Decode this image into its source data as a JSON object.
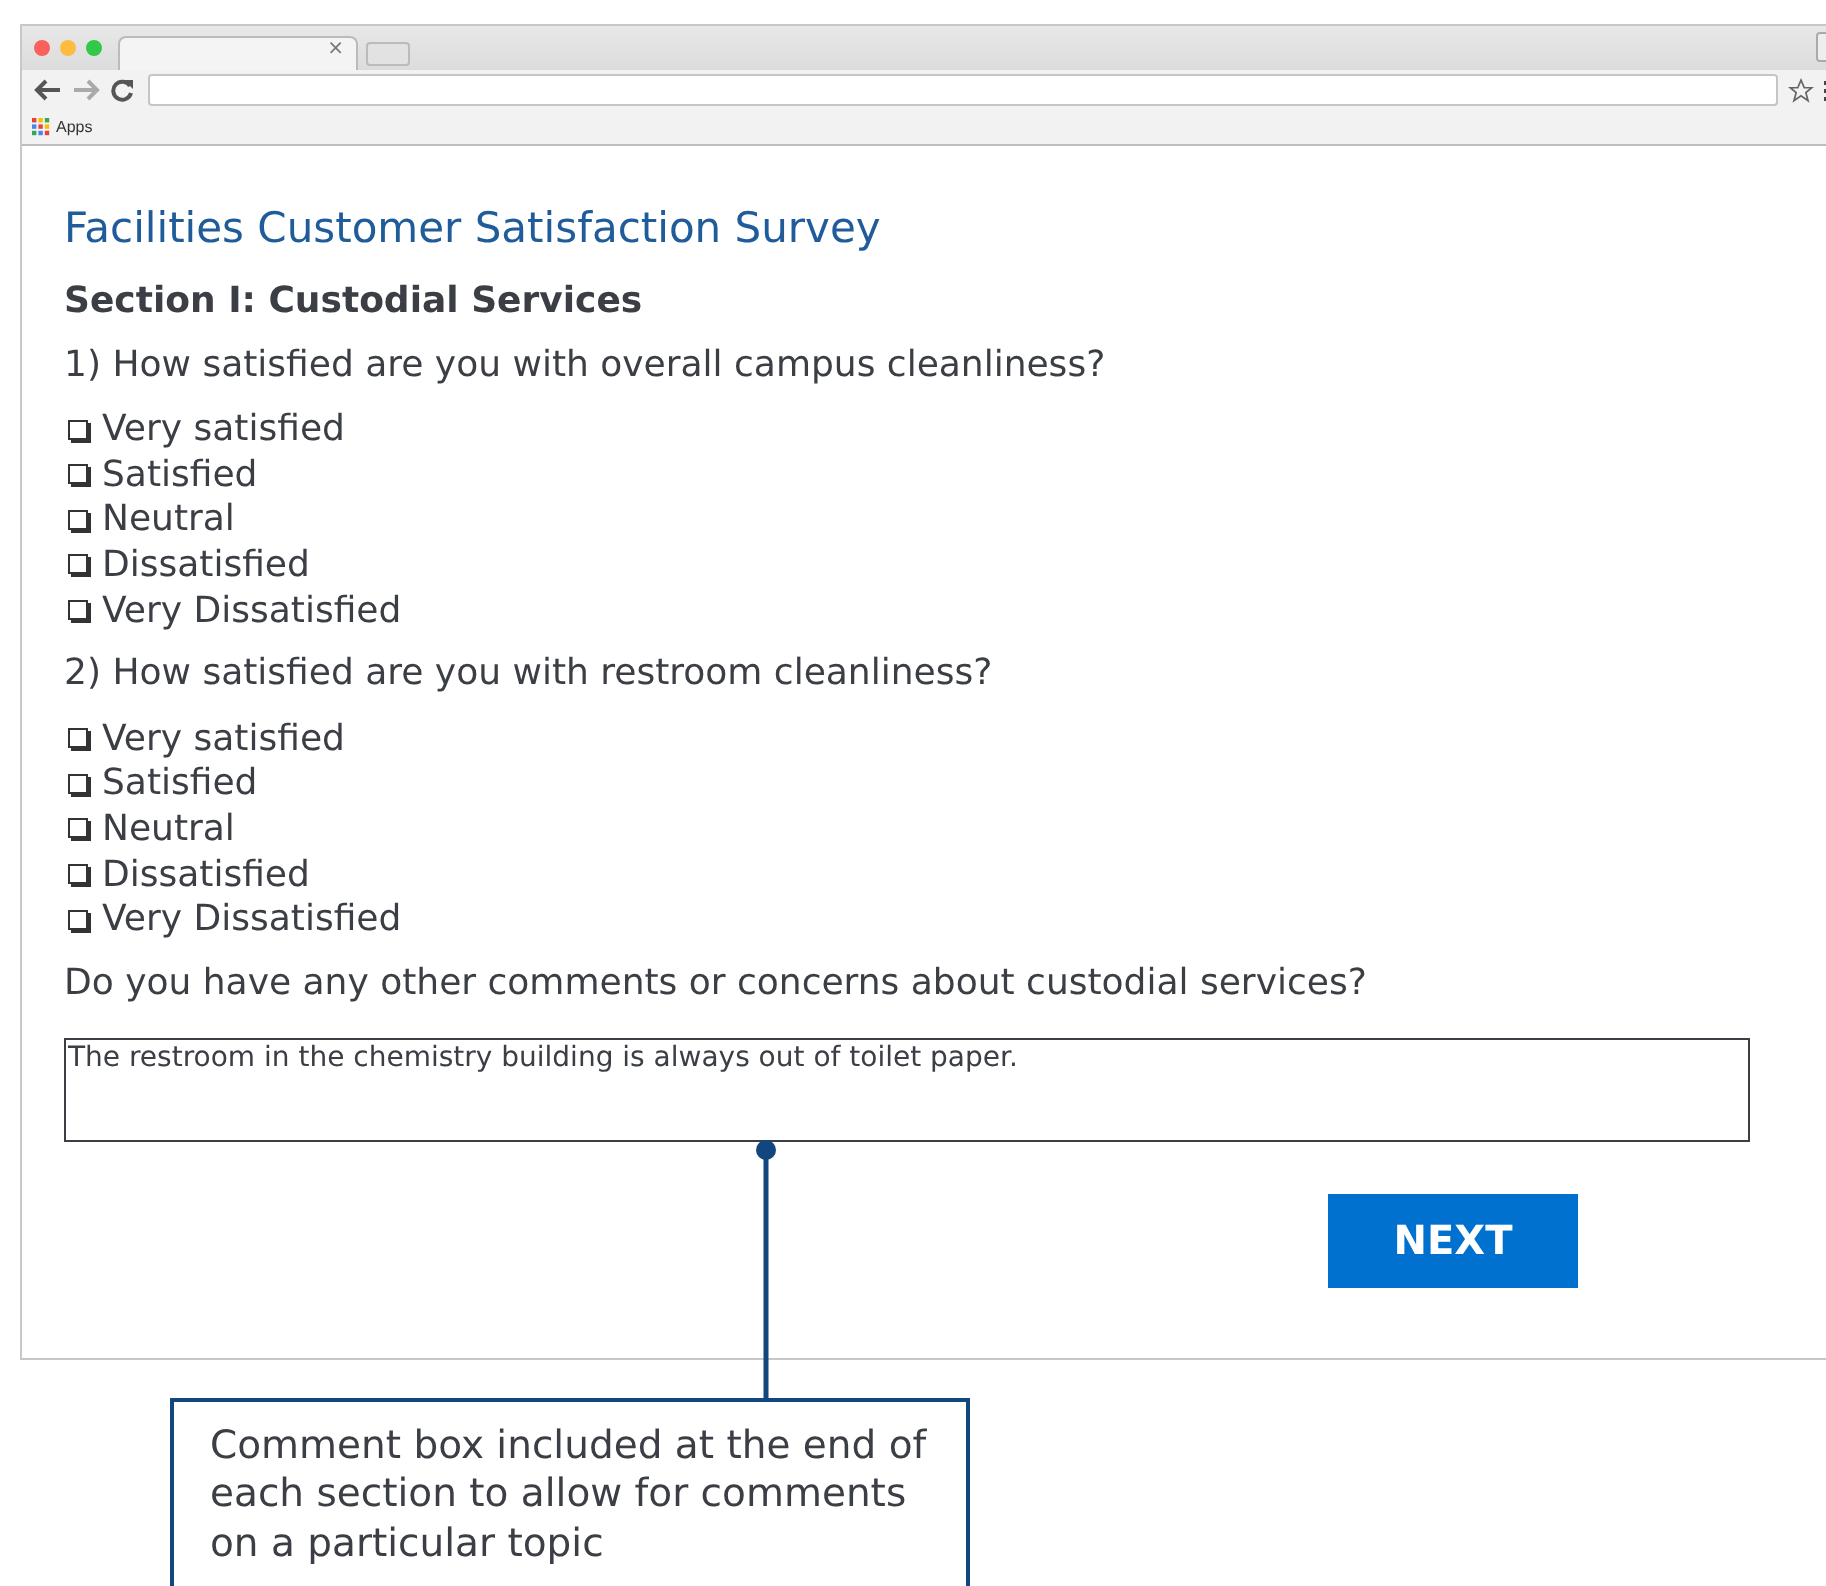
{
  "browser": {
    "tab_close": "×",
    "bookmark": "Apps"
  },
  "survey": {
    "title": "Facilities Customer Satisfaction Survey",
    "section": "Section I: Custodial Services",
    "questions": [
      {
        "text": "1) How satisfied are you with overall campus cleanliness?",
        "options": [
          {
            "label": "Very satisfied",
            "checked": false
          },
          {
            "label": "Satisfied",
            "checked": false
          },
          {
            "label": "Neutral",
            "checked": false
          },
          {
            "label": "Dissatisfied",
            "checked": false
          },
          {
            "label": "Very Dissatisfied",
            "checked": false
          }
        ]
      },
      {
        "text": "2) How satisfied are you with restroom cleanliness?",
        "options": [
          {
            "label": "Very satisfied",
            "checked": false
          },
          {
            "label": "Satisfied",
            "checked": false
          },
          {
            "label": "Neutral",
            "checked": false
          },
          {
            "label": "Dissatisfied",
            "checked": false
          },
          {
            "label": "Very Dissatisfied",
            "checked": false
          }
        ]
      }
    ],
    "comment_prompt": "Do you have any other comments or concerns about custodial services?",
    "comment_value": "The restroom in the chemistry building is always out of toilet paper.",
    "next_button": "NEXT"
  },
  "callout": {
    "text": "Comment box included at the end of each section to allow for comments on a particular topic"
  }
}
